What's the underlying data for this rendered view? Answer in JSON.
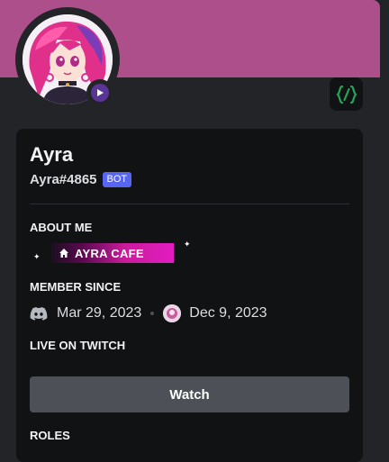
{
  "profile": {
    "display_name": "Ayra",
    "username": "Ayra#4865",
    "bot_badge": "BOT"
  },
  "sections": {
    "about_me": "ABOUT ME",
    "member_since": "MEMBER SINCE",
    "live_on_twitch": "LIVE ON TWITCH",
    "roles": "ROLES"
  },
  "about": {
    "badge_text": "AYRA CAFE",
    "badge_icon": "home-icon"
  },
  "member": {
    "discord_date": "Mar 29, 2023",
    "server_date": "Dec 9, 2023"
  },
  "twitch": {
    "watch_label": "Watch"
  },
  "icons": {
    "status": "play-icon",
    "commands": "slash-command-icon",
    "discord": "discord-icon"
  },
  "colors": {
    "banner": "#ad4f8b",
    "card": "#111214",
    "background": "#232428",
    "bot_badge": "#5865f2",
    "command_icon": "#23a55a",
    "status": "#593695",
    "watch_button": "#4e5058"
  }
}
